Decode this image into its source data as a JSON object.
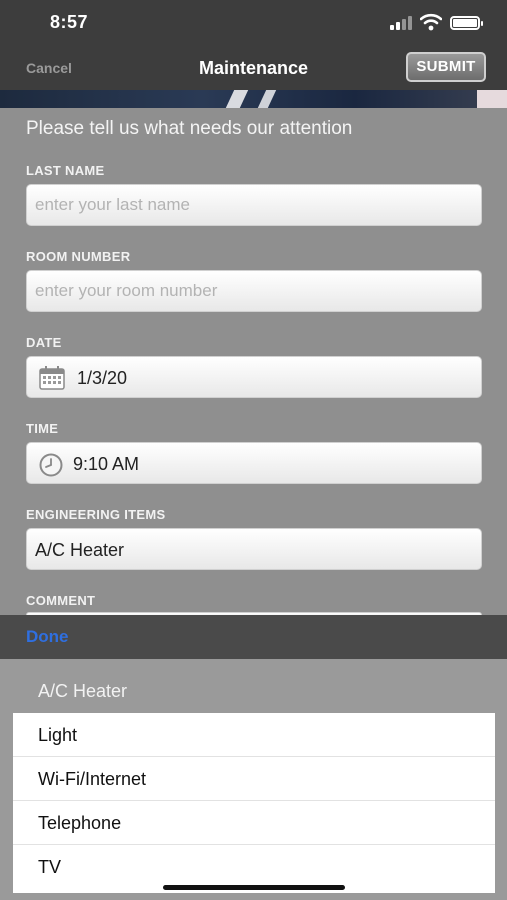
{
  "status_bar": {
    "time": "8:57"
  },
  "nav": {
    "cancel": "Cancel",
    "title": "Maintenance",
    "submit": "SUBMIT"
  },
  "form": {
    "prompt": "Please tell us what needs our attention",
    "last_name": {
      "label": "LAST NAME",
      "placeholder": "enter your last name"
    },
    "room_number": {
      "label": "ROOM NUMBER",
      "placeholder": "enter your room number"
    },
    "date": {
      "label": "DATE",
      "value": "1/3/20",
      "icon": "calendar-icon"
    },
    "time": {
      "label": "TIME",
      "value": "9:10 AM",
      "icon": "clock-icon"
    },
    "engineering_items": {
      "label": "ENGINEERING ITEMS",
      "value": "A/C Heater"
    },
    "comment": {
      "label": "COMMENT"
    }
  },
  "picker": {
    "done": "Done",
    "selected": "A/C Heater",
    "options": [
      "Light",
      "Wi-Fi/Internet",
      "Telephone",
      "TV"
    ]
  },
  "colors": {
    "accent": "#2f6fe0",
    "nav_bg": "#3d3d3d",
    "overlay_bg": "#8f8f8f"
  }
}
